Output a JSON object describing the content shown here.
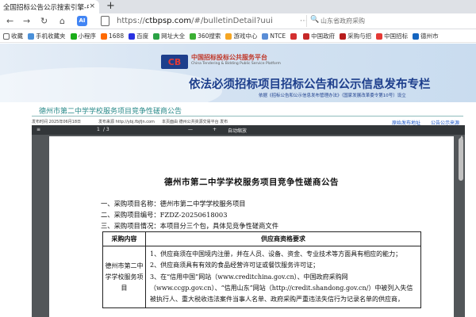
{
  "browser": {
    "tab_title": "全国招标公告公示搜索引擎-中国",
    "tab_close": "×",
    "new_tab": "+",
    "nav_back": "←",
    "nav_forward": "→",
    "nav_reload": "↻",
    "nav_home": "⌂",
    "ext_badge": "AI",
    "url_scheme": "https://",
    "url_host": "ctbpsp.com",
    "url_path": "/#/bulletinDetail?uui",
    "url_more": "⋯",
    "search_icon": "🔍",
    "search_placeholder": "山东省政府采购"
  },
  "bookmarks": [
    {
      "label": "收藏",
      "color": "#ffffff",
      "icon": "menu-icon"
    },
    {
      "label": "手机收藏夹",
      "color": "#4a90d9",
      "icon": "phone-icon"
    },
    {
      "label": "小程序",
      "color": "#1aad19",
      "icon": "miniapp-icon"
    },
    {
      "label": "1688",
      "color": "#ff6a00",
      "icon": "1688-icon"
    },
    {
      "label": "百度",
      "color": "#2932e1",
      "icon": "baidu-icon"
    },
    {
      "label": "网址大全",
      "color": "#2ba245",
      "icon": "navigation-icon"
    },
    {
      "label": "360搜索",
      "color": "#3cb034",
      "icon": "so360-icon"
    },
    {
      "label": "游戏中心",
      "color": "#f5a623",
      "icon": "game-icon"
    },
    {
      "label": "NTCE",
      "color": "#5a8dd6",
      "icon": "ntce-icon"
    },
    {
      "label": "",
      "color": "#d32f2f",
      "icon": "site-icon"
    },
    {
      "label": "中国政府",
      "color": "#c62828",
      "icon": "gov-icon"
    },
    {
      "label": "采购与招",
      "color": "#b71c1c",
      "icon": "procure-icon"
    },
    {
      "label": "中国招标",
      "color": "#e53935",
      "icon": "tender-icon"
    },
    {
      "label": "德州市",
      "color": "#1565c0",
      "icon": "dezhou-icon"
    }
  ],
  "banner": {
    "logo_text": "CB",
    "platform_cn": "中国招标投标公共服务平台",
    "platform_en": "China Tendering & Bidding Public Service Platform",
    "title": "依法必须招标项目招标公告和公示信息发布专栏",
    "subtitle": "依据《招标公告和公示信息发布管理办法》（国家发展改革委令第10号）设立"
  },
  "notice": {
    "title": "德州市第二中学学校服务项目竞争性磋商公告",
    "published": "发布时间 2025年06月18日",
    "source": "发布来源 http://ybj.fbjfjn.com",
    "platform": "本页面由 德州公共资源交易平台 发布",
    "link_original": "原始发布地址",
    "link_network": "公告公示来源"
  },
  "pdf": {
    "menu_icon": "≡",
    "page_current": "1",
    "page_total": "/ 3",
    "zoom_out": "—",
    "zoom_in": "+",
    "zoom_label": "自动缩放",
    "scroll_up": "▲"
  },
  "document": {
    "title": "德州市第二中学学校服务项目竞争性磋商公告",
    "lines": [
      "一、采购项目名称：德州市第二中学学校服务项目",
      "二、采购项目编号：FZDZ-20250618003",
      "三、采购项目情况：本项目分三个包，具体见竞争性磋商文件"
    ],
    "table": {
      "headers": [
        "采购内容",
        "供应商资格要求"
      ],
      "row_left": "德州市第二中学学校服务项目",
      "row_right": [
        "1、供应商须在中国境内注册，并在人员、设备、资金、专业技术等方面具有相应的能力；",
        "2、供应商须具有有效的食品经营许可证或餐饮服务许可证；",
        "3、在“信用中国”网站（www.creditchina.gov.cn）、中国政府采购网（www.ccgp.gov.cn）、“信用山东”网站（http://credit.shandong.gov.cn/）中被列入失信被执行人、重大税收违法案件当事人名单、政府采购严重违法失信行为记录名单的供应商，"
      ]
    }
  }
}
